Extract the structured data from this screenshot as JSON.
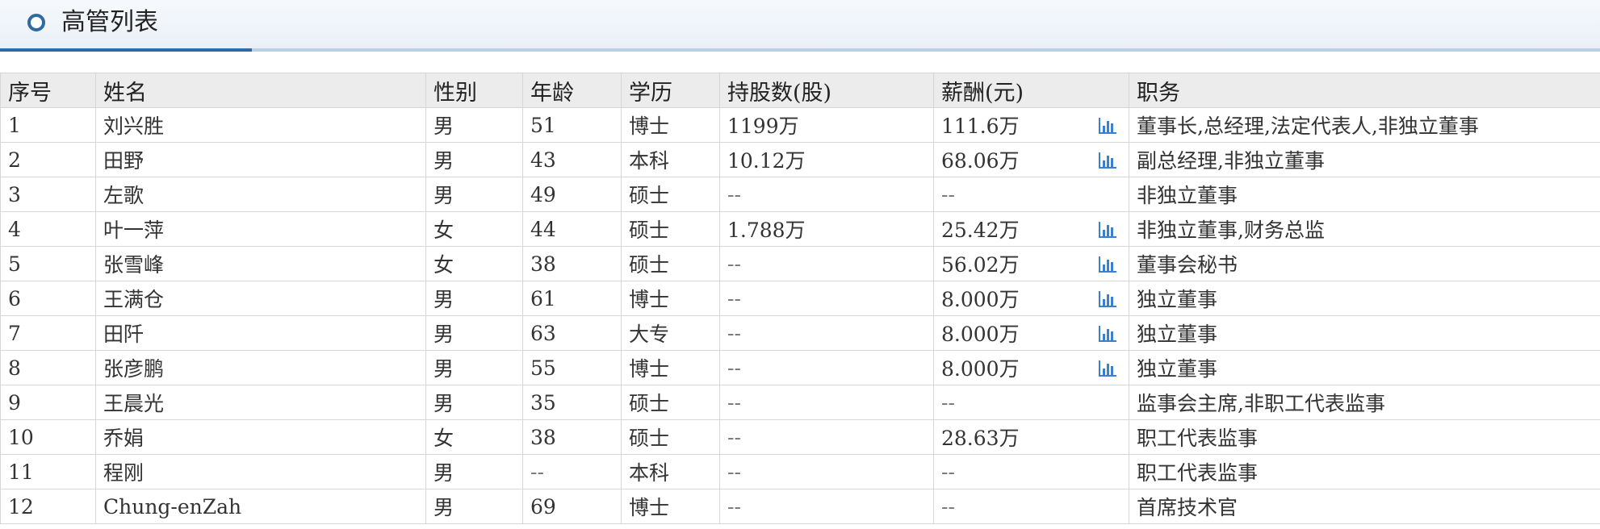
{
  "header": {
    "title": "高管列表"
  },
  "colors": {
    "accent": "#2e6aa4",
    "accent_light": "#b9cfe6",
    "icon_blue": "#3b7fd0",
    "header_bg": "#ececec"
  },
  "table": {
    "columns": [
      "序号",
      "姓名",
      "性别",
      "年龄",
      "学历",
      "持股数(股)",
      "薪酬(元)",
      "职务"
    ],
    "rows": [
      {
        "no": "1",
        "name": "刘兴胜",
        "gender": "男",
        "age": "51",
        "edu": "博士",
        "shares": "1199万",
        "salary": "111.6万",
        "chart": true,
        "title": "董事长,总经理,法定代表人,非独立董事"
      },
      {
        "no": "2",
        "name": "田野",
        "gender": "男",
        "age": "43",
        "edu": "本科",
        "shares": "10.12万",
        "salary": "68.06万",
        "chart": true,
        "title": "副总经理,非独立董事"
      },
      {
        "no": "3",
        "name": "左歌",
        "gender": "男",
        "age": "49",
        "edu": "硕士",
        "shares": "--",
        "salary": "--",
        "chart": false,
        "title": "非独立董事"
      },
      {
        "no": "4",
        "name": "叶一萍",
        "gender": "女",
        "age": "44",
        "edu": "硕士",
        "shares": "1.788万",
        "salary": "25.42万",
        "chart": true,
        "title": "非独立董事,财务总监"
      },
      {
        "no": "5",
        "name": "张雪峰",
        "gender": "女",
        "age": "38",
        "edu": "硕士",
        "shares": "--",
        "salary": "56.02万",
        "chart": true,
        "title": "董事会秘书"
      },
      {
        "no": "6",
        "name": "王满仓",
        "gender": "男",
        "age": "61",
        "edu": "博士",
        "shares": "--",
        "salary": "8.000万",
        "chart": true,
        "title": "独立董事"
      },
      {
        "no": "7",
        "name": "田阡",
        "gender": "男",
        "age": "63",
        "edu": "大专",
        "shares": "--",
        "salary": "8.000万",
        "chart": true,
        "title": "独立董事"
      },
      {
        "no": "8",
        "name": "张彦鹏",
        "gender": "男",
        "age": "55",
        "edu": "博士",
        "shares": "--",
        "salary": "8.000万",
        "chart": true,
        "title": "独立董事"
      },
      {
        "no": "9",
        "name": "王晨光",
        "gender": "男",
        "age": "35",
        "edu": "硕士",
        "shares": "--",
        "salary": "--",
        "chart": false,
        "title": "监事会主席,非职工代表监事"
      },
      {
        "no": "10",
        "name": "乔娟",
        "gender": "女",
        "age": "38",
        "edu": "硕士",
        "shares": "--",
        "salary": "28.63万",
        "chart": false,
        "title": "职工代表监事"
      },
      {
        "no": "11",
        "name": "程刚",
        "gender": "男",
        "age": "--",
        "edu": "本科",
        "shares": "--",
        "salary": "--",
        "chart": false,
        "title": "职工代表监事"
      },
      {
        "no": "12",
        "name": "Chung-enZah",
        "gender": "男",
        "age": "69",
        "edu": "博士",
        "shares": "--",
        "salary": "--",
        "chart": false,
        "title": "首席技术官"
      }
    ]
  }
}
